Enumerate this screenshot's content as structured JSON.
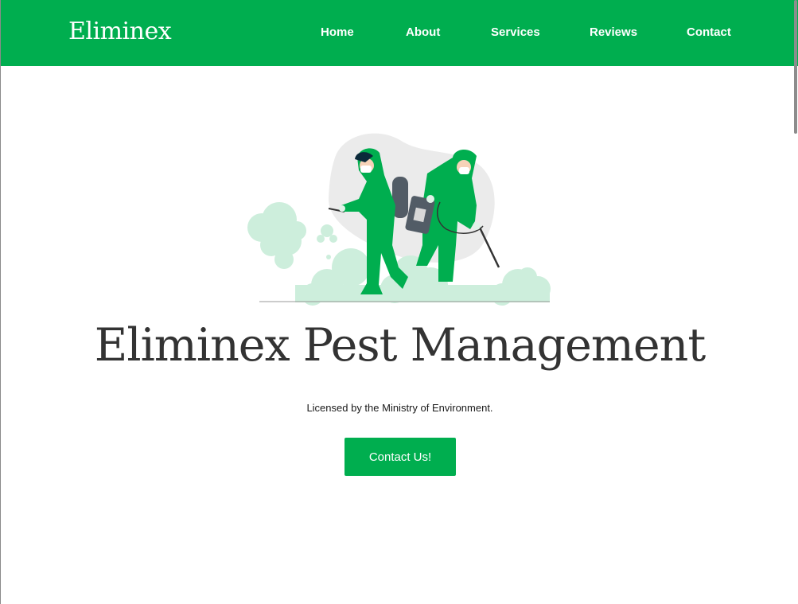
{
  "navbar": {
    "brand": "Eliminex",
    "links": [
      "Home",
      "About",
      "Services",
      "Reviews",
      "Contact"
    ]
  },
  "hero": {
    "illustration_icon": "pest-control-workers-spraying-icon",
    "title": "Eliminex Pest Management",
    "subtitle": "Licensed by the Ministry of Environment.",
    "cta_label": "Contact Us!"
  },
  "colors": {
    "brand_green": "#00ae4f",
    "light_green": "#cdeedc",
    "text_dark": "#333333"
  }
}
